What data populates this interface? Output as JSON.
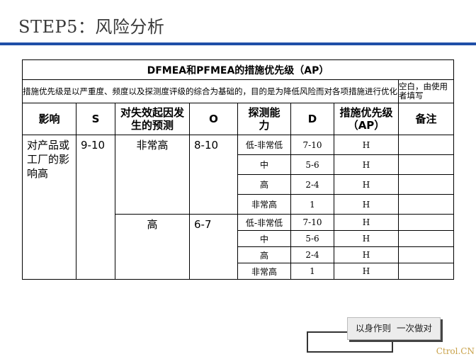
{
  "header": {
    "title": "STEP5：风险分析"
  },
  "table": {
    "title": "DFMEA和PFMEA的措施优先级（AP）",
    "description": "措施优先级是以严重度、频度以及探测度评级的综合为基础的，目的是为降低风险而对各项措施进行优化",
    "note_header": "空白，由使用者填写",
    "headers": {
      "impact": "影响",
      "s": "S",
      "prediction": "对失效起因发生的预测",
      "o": "O",
      "detection": "探测能力",
      "d": "D",
      "ap": "措施优先级（AP）",
      "remark": "备注"
    },
    "impact_text": "对产品或工厂的影响高",
    "s_value": "9-10",
    "groups": [
      {
        "prediction": "非常高",
        "o": "8-10",
        "rows": [
          {
            "detection": "低-非常低",
            "d": "7-10",
            "ap": "H",
            "remark": ""
          },
          {
            "detection": "中",
            "d": "5-6",
            "ap": "H",
            "remark": ""
          },
          {
            "detection": "高",
            "d": "2-4",
            "ap": "H",
            "remark": ""
          },
          {
            "detection": "非常高",
            "d": "1",
            "ap": "H",
            "remark": ""
          }
        ]
      },
      {
        "prediction": "高",
        "o": "6-7",
        "rows": [
          {
            "detection": "低-非常低",
            "d": "7-10",
            "ap": "H",
            "remark": ""
          },
          {
            "detection": "中",
            "d": "5-6",
            "ap": "H",
            "remark": ""
          },
          {
            "detection": "高",
            "d": "2-4",
            "ap": "H",
            "remark": ""
          },
          {
            "detection": "非常高",
            "d": "1",
            "ap": "H",
            "remark": ""
          }
        ]
      }
    ]
  },
  "stamp": {
    "text": "以身作则  一次做对"
  },
  "watermark": "Ctrol.CN"
}
